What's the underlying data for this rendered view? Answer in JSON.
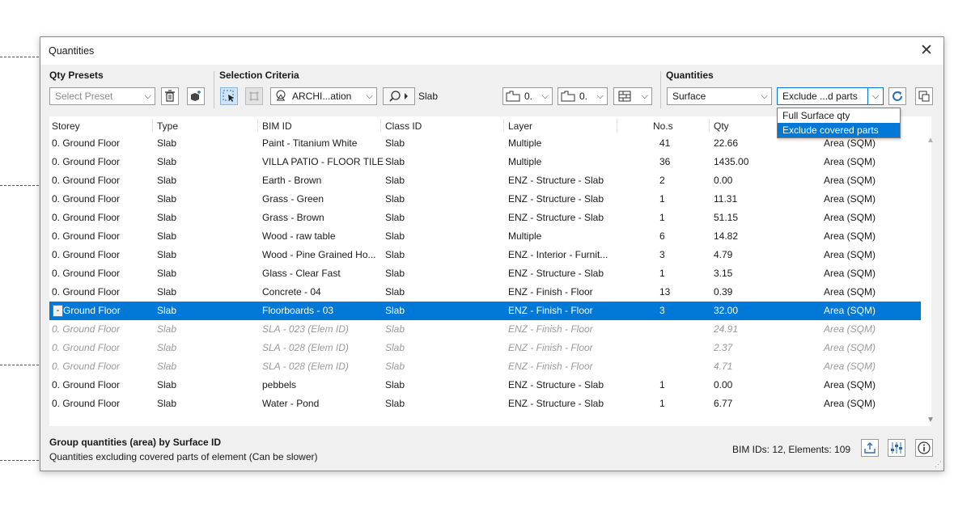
{
  "window": {
    "title": "Quantities",
    "close_glyph": "✕"
  },
  "toolbar": {
    "qty_presets_label": "Qty Presets",
    "select_preset_placeholder": "Select Preset",
    "selection_criteria_label": "Selection Criteria",
    "classification_value": "ARCHI...ation",
    "element_type": "Slab",
    "storey_from": "0.",
    "storey_to": "0.",
    "quantities_label": "Quantities",
    "quantity_type": "Surface",
    "surface_mode": "Exclude ...d parts"
  },
  "dropdown": {
    "options": [
      "Full Surface qty",
      "Exclude covered parts"
    ],
    "highlighted": "Exclude covered parts"
  },
  "table": {
    "columns": [
      "Storey",
      "Type",
      "BIM ID",
      "Class ID",
      "Layer",
      "No.s",
      "Qty",
      "Area (SQM)"
    ],
    "rows": [
      {
        "storey": "0. Ground Floor",
        "type": "Slab",
        "bim_id": "Paint - Titanium White",
        "class_id": "Slab",
        "layer": "Multiple",
        "nos": "41",
        "qty": "22.66",
        "unit": "Area (SQM)",
        "state": "normal"
      },
      {
        "storey": "0. Ground Floor",
        "type": "Slab",
        "bim_id": "VILLA PATIO - FLOOR TILE",
        "class_id": "Slab",
        "layer": "Multiple",
        "nos": "36",
        "qty": "1435.00",
        "unit": "Area (SQM)",
        "state": "normal"
      },
      {
        "storey": "0. Ground Floor",
        "type": "Slab",
        "bim_id": "Earth - Brown",
        "class_id": "Slab",
        "layer": "ENZ - Structure - Slab",
        "nos": "2",
        "qty": "0.00",
        "unit": "Area (SQM)",
        "state": "normal"
      },
      {
        "storey": "0. Ground Floor",
        "type": "Slab",
        "bim_id": "Grass - Green",
        "class_id": "Slab",
        "layer": "ENZ - Structure - Slab",
        "nos": "1",
        "qty": "11.31",
        "unit": "Area (SQM)",
        "state": "normal"
      },
      {
        "storey": "0. Ground Floor",
        "type": "Slab",
        "bim_id": "Grass - Brown",
        "class_id": "Slab",
        "layer": "ENZ - Structure - Slab",
        "nos": "1",
        "qty": "51.15",
        "unit": "Area (SQM)",
        "state": "normal"
      },
      {
        "storey": "0. Ground Floor",
        "type": "Slab",
        "bim_id": "Wood - raw table",
        "class_id": "Slab",
        "layer": "Multiple",
        "nos": "6",
        "qty": "14.82",
        "unit": "Area (SQM)",
        "state": "normal"
      },
      {
        "storey": "0. Ground Floor",
        "type": "Slab",
        "bim_id": "Wood - Pine Grained Ho...",
        "class_id": "Slab",
        "layer": "ENZ - Interior - Furnit...",
        "nos": "3",
        "qty": "4.79",
        "unit": "Area (SQM)",
        "state": "normal"
      },
      {
        "storey": "0. Ground Floor",
        "type": "Slab",
        "bim_id": "Glass - Clear Fast",
        "class_id": "Slab",
        "layer": "ENZ - Structure - Slab",
        "nos": "1",
        "qty": "3.15",
        "unit": "Area (SQM)",
        "state": "normal"
      },
      {
        "storey": "0. Ground Floor",
        "type": "Slab",
        "bim_id": "Concrete - 04",
        "class_id": "Slab",
        "layer": "ENZ - Finish - Floor",
        "nos": "13",
        "qty": "0.39",
        "unit": "Area (SQM)",
        "state": "normal"
      },
      {
        "storey": "Ground Floor",
        "type": "Slab",
        "bim_id": "Floorboards - 03",
        "class_id": "Slab",
        "layer": "ENZ - Finish - Floor",
        "nos": "3",
        "qty": "32.00",
        "unit": "Area (SQM)",
        "state": "selected",
        "expander": "-"
      },
      {
        "storey": "0. Ground Floor",
        "type": "Slab",
        "bim_id": "SLA - 023 (Elem ID)",
        "class_id": "Slab",
        "layer": "ENZ - Finish - Floor",
        "nos": "",
        "qty": "24.91",
        "unit": "Area (SQM)",
        "state": "child"
      },
      {
        "storey": "0. Ground Floor",
        "type": "Slab",
        "bim_id": "SLA - 028 (Elem ID)",
        "class_id": "Slab",
        "layer": "ENZ - Finish - Floor",
        "nos": "",
        "qty": "2.37",
        "unit": "Area (SQM)",
        "state": "child"
      },
      {
        "storey": "0. Ground Floor",
        "type": "Slab",
        "bim_id": "SLA - 028 (Elem ID)",
        "class_id": "Slab",
        "layer": "ENZ - Finish - Floor",
        "nos": "",
        "qty": "4.71",
        "unit": "Area (SQM)",
        "state": "child"
      },
      {
        "storey": "0. Ground Floor",
        "type": "Slab",
        "bim_id": "pebbels",
        "class_id": "Slab",
        "layer": "ENZ - Structure - Slab",
        "nos": "1",
        "qty": "0.00",
        "unit": "Area (SQM)",
        "state": "normal"
      },
      {
        "storey": "0. Ground Floor",
        "type": "Slab",
        "bim_id": "Water - Pond",
        "class_id": "Slab",
        "layer": "ENZ - Structure - Slab",
        "nos": "1",
        "qty": "6.77",
        "unit": "Area (SQM)",
        "state": "normal"
      }
    ]
  },
  "footer": {
    "group_by": "Group quantities (area) by Surface ID",
    "description": "Quantities excluding covered parts of element (Can be slower)",
    "status": "BIM IDs: 12, Elements: 109"
  },
  "icons": {
    "dropdown_arrow": "⌵",
    "export": "export-icon",
    "filter_settings": "filter-settings-icon",
    "info": "info-icon",
    "refresh": "refresh-icon"
  },
  "colors": {
    "selection": "#0078d7",
    "window_bg": "#f0f0f0",
    "accent_icon": "#2a6fb5"
  }
}
